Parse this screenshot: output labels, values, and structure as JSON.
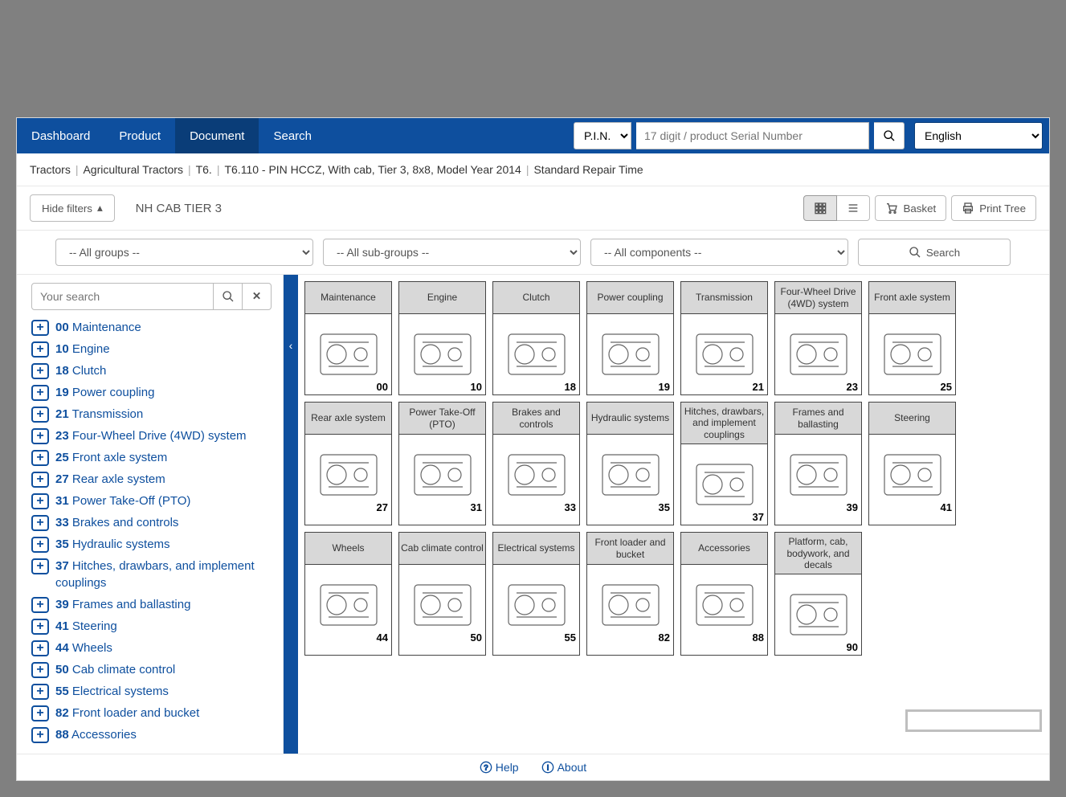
{
  "nav": {
    "items": [
      "Dashboard",
      "Product",
      "Document",
      "Search"
    ],
    "active_index": 2,
    "pin_label": "P.I.N.",
    "serial_placeholder": "17 digit / product Serial Number",
    "language": "English"
  },
  "breadcrumb": [
    "Tractors",
    "Agricultural Tractors",
    "T6.",
    "T6.110 - PIN HCCZ, With cab, Tier 3, 8x8, Model Year 2014",
    "Standard Repair Time"
  ],
  "toolbar": {
    "hide_filters": "Hide filters",
    "page_title": "NH CAB TIER 3",
    "basket": "Basket",
    "print_tree": "Print Tree"
  },
  "filters": {
    "groups": "-- All groups --",
    "subgroups": "-- All sub-groups --",
    "components": "-- All components --",
    "search": "Search"
  },
  "sidebar": {
    "search_placeholder": "Your search"
  },
  "categories": [
    {
      "code": "00",
      "label": "Maintenance"
    },
    {
      "code": "10",
      "label": "Engine"
    },
    {
      "code": "18",
      "label": "Clutch"
    },
    {
      "code": "19",
      "label": "Power coupling"
    },
    {
      "code": "21",
      "label": "Transmission"
    },
    {
      "code": "23",
      "label": "Four-Wheel Drive (4WD) system"
    },
    {
      "code": "25",
      "label": "Front axle system"
    },
    {
      "code": "27",
      "label": "Rear axle system"
    },
    {
      "code": "31",
      "label": "Power Take-Off (PTO)"
    },
    {
      "code": "33",
      "label": "Brakes and controls"
    },
    {
      "code": "35",
      "label": "Hydraulic systems"
    },
    {
      "code": "37",
      "label": "Hitches, drawbars, and implement couplings"
    },
    {
      "code": "39",
      "label": "Frames and ballasting"
    },
    {
      "code": "41",
      "label": "Steering"
    },
    {
      "code": "44",
      "label": "Wheels"
    },
    {
      "code": "50",
      "label": "Cab climate control"
    },
    {
      "code": "55",
      "label": "Electrical systems"
    },
    {
      "code": "82",
      "label": "Front loader and bucket"
    },
    {
      "code": "88",
      "label": "Accessories"
    },
    {
      "code": "90",
      "label": "Platform, cab, bodywork, and decals"
    }
  ],
  "footer": {
    "help": "Help",
    "about": "About"
  }
}
